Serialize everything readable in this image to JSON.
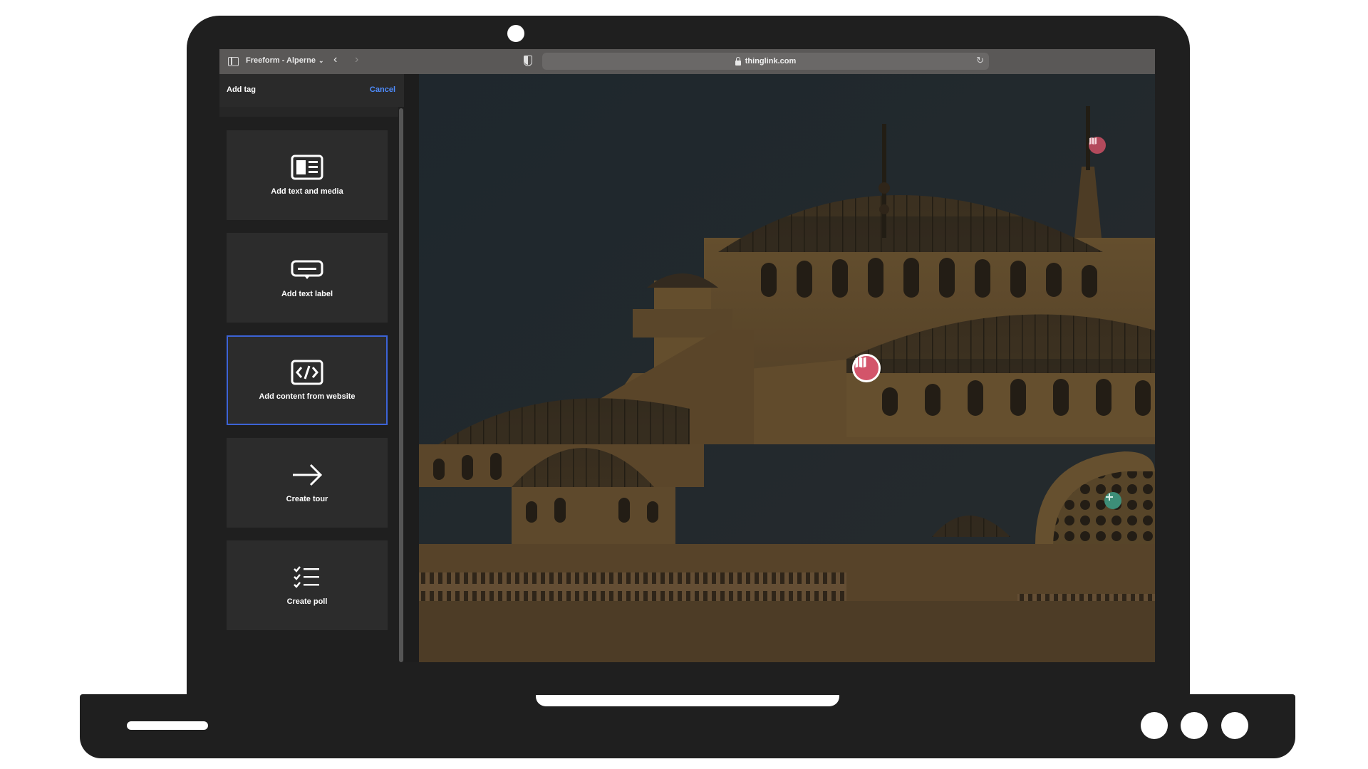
{
  "browser": {
    "tab_group_label": "Freeform - Alperne",
    "url": "thinglink.com"
  },
  "panel": {
    "title": "Add tag",
    "cancel_label": "Cancel",
    "cards": [
      {
        "label": "Add text and media",
        "icon": "text-media-icon",
        "selected": false
      },
      {
        "label": "Add text label",
        "icon": "text-label-icon",
        "selected": false
      },
      {
        "label": "Add content from website",
        "icon": "embed-code-icon",
        "selected": true
      },
      {
        "label": "Create tour",
        "icon": "arrow-right-icon",
        "selected": false
      },
      {
        "label": "Create poll",
        "icon": "checklist-icon",
        "selected": false
      }
    ]
  },
  "canvas": {
    "image": "mosque-photo",
    "hotspots": [
      {
        "icon": "map-icon",
        "color": "#c54f63"
      },
      {
        "icon": "map-icon",
        "color": "#d3546a"
      },
      {
        "icon": "plus-icon",
        "color": "#3d8e78"
      }
    ]
  },
  "colors": {
    "accent": "#4f8dff",
    "selected_border": "#3c63d6"
  }
}
